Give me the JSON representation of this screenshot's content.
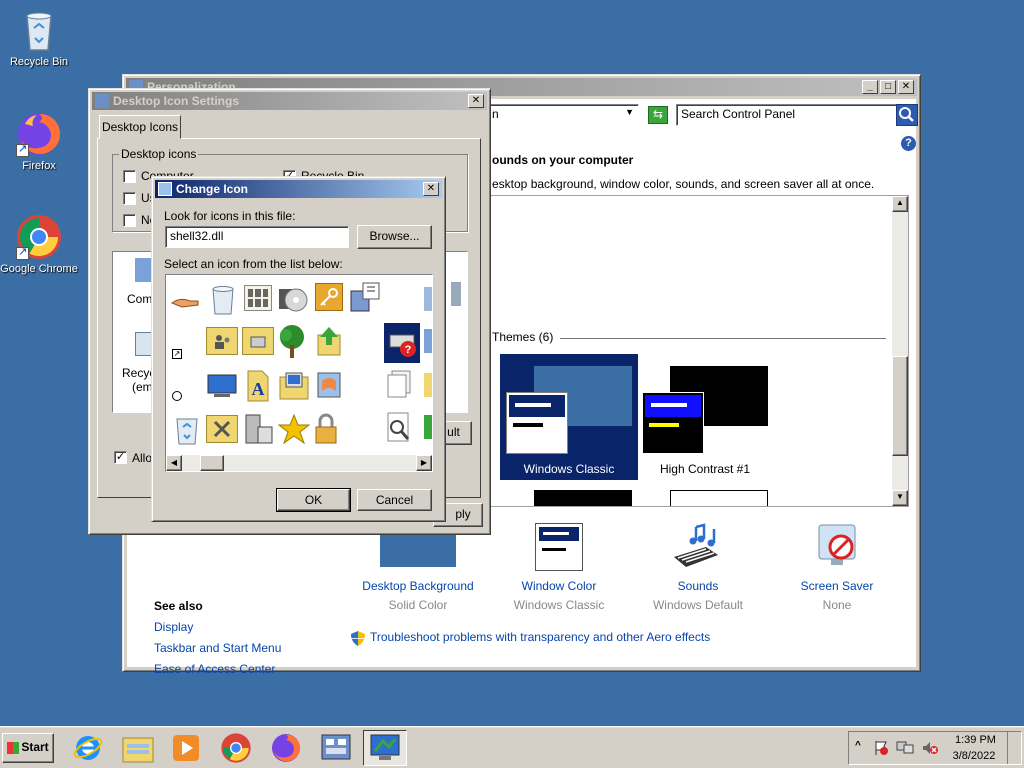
{
  "desktop": {
    "icons": [
      {
        "name": "recycle-bin",
        "label": "Recycle Bin"
      },
      {
        "name": "firefox",
        "label": "Firefox"
      },
      {
        "name": "google-chrome",
        "label": "Google Chrome"
      }
    ]
  },
  "personalization": {
    "title": "Personalization",
    "address_fragment": "n",
    "search_placeholder": "Search Control Panel",
    "heading": "ounds on your computer",
    "description": "esktop background, window color, sounds, and screen saver all at once.",
    "themes_header": "Themes (6)",
    "themes": [
      {
        "label": "Windows Classic",
        "selected": true
      },
      {
        "label": "High Contrast #1",
        "selected": false
      }
    ],
    "see_also": {
      "title": "See also",
      "links": [
        "Display",
        "Taskbar and Start Menu",
        "Ease of Access Center"
      ]
    },
    "bottom_items": [
      {
        "title": "Desktop Background",
        "subtitle": "Solid Color"
      },
      {
        "title": "Window Color",
        "subtitle": "Windows Classic"
      },
      {
        "title": "Sounds",
        "subtitle": "Windows Default"
      },
      {
        "title": "Screen Saver",
        "subtitle": "None"
      }
    ],
    "troubleshoot": "Troubleshoot problems with transparency and other Aero effects"
  },
  "desktop_icon_settings": {
    "title": "Desktop Icon Settings",
    "tab": "Desktop Icons",
    "group_label": "Desktop icons",
    "checkboxes": [
      {
        "label": "Computer",
        "checked": false
      },
      {
        "label": "Us",
        "checked": false
      },
      {
        "label": "Ne",
        "checked": false
      },
      {
        "label": "Recycle Bin",
        "checked": true
      }
    ],
    "preview_labels": [
      "Comp",
      "Recyc",
      "(emp"
    ],
    "allow_label": "Allov",
    "restore_default_fragment": "ult",
    "apply_fragment": "ply"
  },
  "change_icon": {
    "title": "Change Icon",
    "look_label": "Look for icons in this file:",
    "file_value": "shell32.dll",
    "browse": "Browse...",
    "select_label": "Select an icon from the list below:",
    "ok": "OK",
    "cancel": "Cancel"
  },
  "taskbar": {
    "start": "Start",
    "apps": [
      "internet-explorer",
      "windows-explorer",
      "media-player",
      "google-chrome",
      "firefox",
      "control-panel",
      "personalization"
    ],
    "time": "1:39 PM",
    "date": "3/8/2022"
  },
  "colors": {
    "desktop": "#3a6ea5",
    "titlebar_active": "#0a246a",
    "selection": "#0a246a",
    "link": "#0645ad"
  }
}
